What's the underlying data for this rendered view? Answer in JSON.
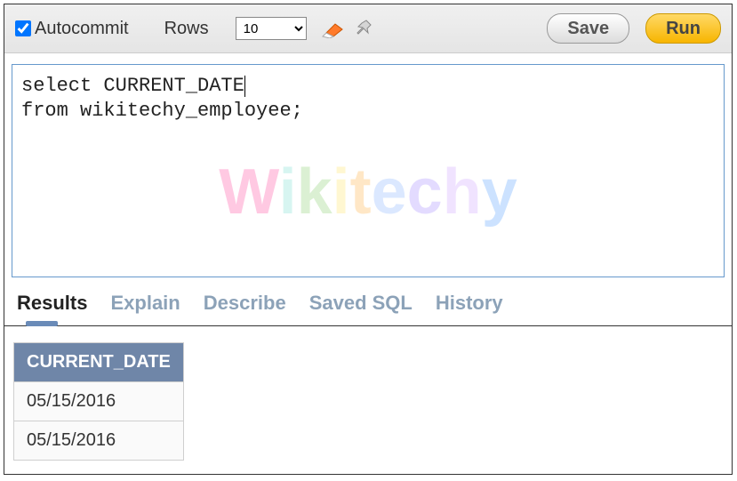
{
  "toolbar": {
    "autocommit_label": "Autocommit",
    "autocommit_checked": true,
    "rows_label": "Rows",
    "rows_value": "10",
    "save_label": "Save",
    "run_label": "Run"
  },
  "editor": {
    "line1": "select CURRENT_DATE",
    "line2": "from wikitechy_employee;"
  },
  "watermark": "Wikitechy",
  "tabs": {
    "results": "Results",
    "explain": "Explain",
    "describe": "Describe",
    "saved_sql": "Saved SQL",
    "history": "History"
  },
  "results": {
    "columns": [
      "CURRENT_DATE"
    ],
    "rows": [
      [
        "05/15/2016"
      ],
      [
        "05/15/2016"
      ]
    ]
  }
}
